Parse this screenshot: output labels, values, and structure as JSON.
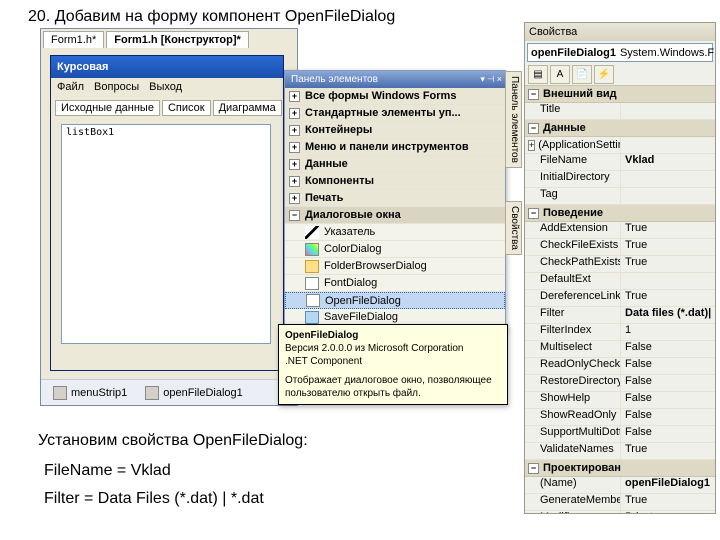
{
  "heading": "20. Добавим на форму компонент OpenFileDialog",
  "subtext": "Установим свойства OpenFileDialog:",
  "line2": "FileName = Vklad",
  "line3": "Filter      =  Data Files (*.dat) | *.dat",
  "designer": {
    "tab_doc": "Form1.h*",
    "tab_design": "Form1.h [Конструктор]*",
    "app_title": "Курсовая",
    "menu": [
      "Файл",
      "Вопросы",
      "Выход"
    ],
    "apptabs": [
      "Исходные данные",
      "Список",
      "Диаграмма"
    ],
    "listbox_label": "listBox1",
    "tray_menu": "menuStrip1",
    "tray_ofd": "openFileDialog1"
  },
  "toolbox": {
    "title": "Панель элементов",
    "sidetab1": "Панель элементов",
    "sidetab2": "Свойства",
    "cats": [
      "Все формы Windows Forms",
      "Стандартные элементы уп...",
      "Контейнеры",
      "Меню и панели инструментов",
      "Данные",
      "Компоненты",
      "Печать",
      "Диалоговые окна"
    ],
    "items": [
      "Указатель",
      "ColorDialog",
      "FolderBrowserDialog",
      "FontDialog",
      "OpenFileDialog",
      "SaveFileDialog"
    ]
  },
  "tooltip": {
    "title": "OpenFileDialog",
    "sub": "Версия 2.0.0.0 из Microsoft Corporation",
    "sub2": ".NET Component",
    "body": "Отображает диалоговое окно, позволяющее пользователю открыть файл."
  },
  "props": {
    "panel_title": "Свойства",
    "obj_name": "openFileDialog1",
    "obj_type": "System.Windows.F",
    "cat_appearance": "Внешний вид",
    "row_title": {
      "n": "Title",
      "v": ""
    },
    "cat_data": "Данные",
    "row_appset": {
      "n": "(ApplicationSettin",
      "v": ""
    },
    "row_filename": {
      "n": "FileName",
      "v": "Vklad"
    },
    "row_initdir": {
      "n": "InitialDirectory",
      "v": ""
    },
    "row_tag": {
      "n": "Tag",
      "v": ""
    },
    "cat_behavior": "Поведение",
    "rows_behavior": [
      {
        "n": "AddExtension",
        "v": "True"
      },
      {
        "n": "CheckFileExists",
        "v": "True"
      },
      {
        "n": "CheckPathExists",
        "v": "True"
      },
      {
        "n": "DefaultExt",
        "v": ""
      },
      {
        "n": "DereferenceLinks",
        "v": "True"
      },
      {
        "n": "Filter",
        "v": "Data files (*.dat)|",
        "bold": true
      },
      {
        "n": "FilterIndex",
        "v": "1"
      },
      {
        "n": "Multiselect",
        "v": "False"
      },
      {
        "n": "ReadOnlyChecke",
        "v": "False"
      },
      {
        "n": "RestoreDirectory",
        "v": "False"
      },
      {
        "n": "ShowHelp",
        "v": "False"
      },
      {
        "n": "ShowReadOnly",
        "v": "False"
      },
      {
        "n": "SupportMultiDott",
        "v": "False"
      },
      {
        "n": "ValidateNames",
        "v": "True"
      }
    ],
    "cat_design": "Проектирован",
    "rows_design": [
      {
        "n": "(Name)",
        "v": "openFileDialog1",
        "bold": true
      },
      {
        "n": "GenerateMembe",
        "v": "True"
      },
      {
        "n": "Modifiers",
        "v": "Private"
      }
    ]
  }
}
